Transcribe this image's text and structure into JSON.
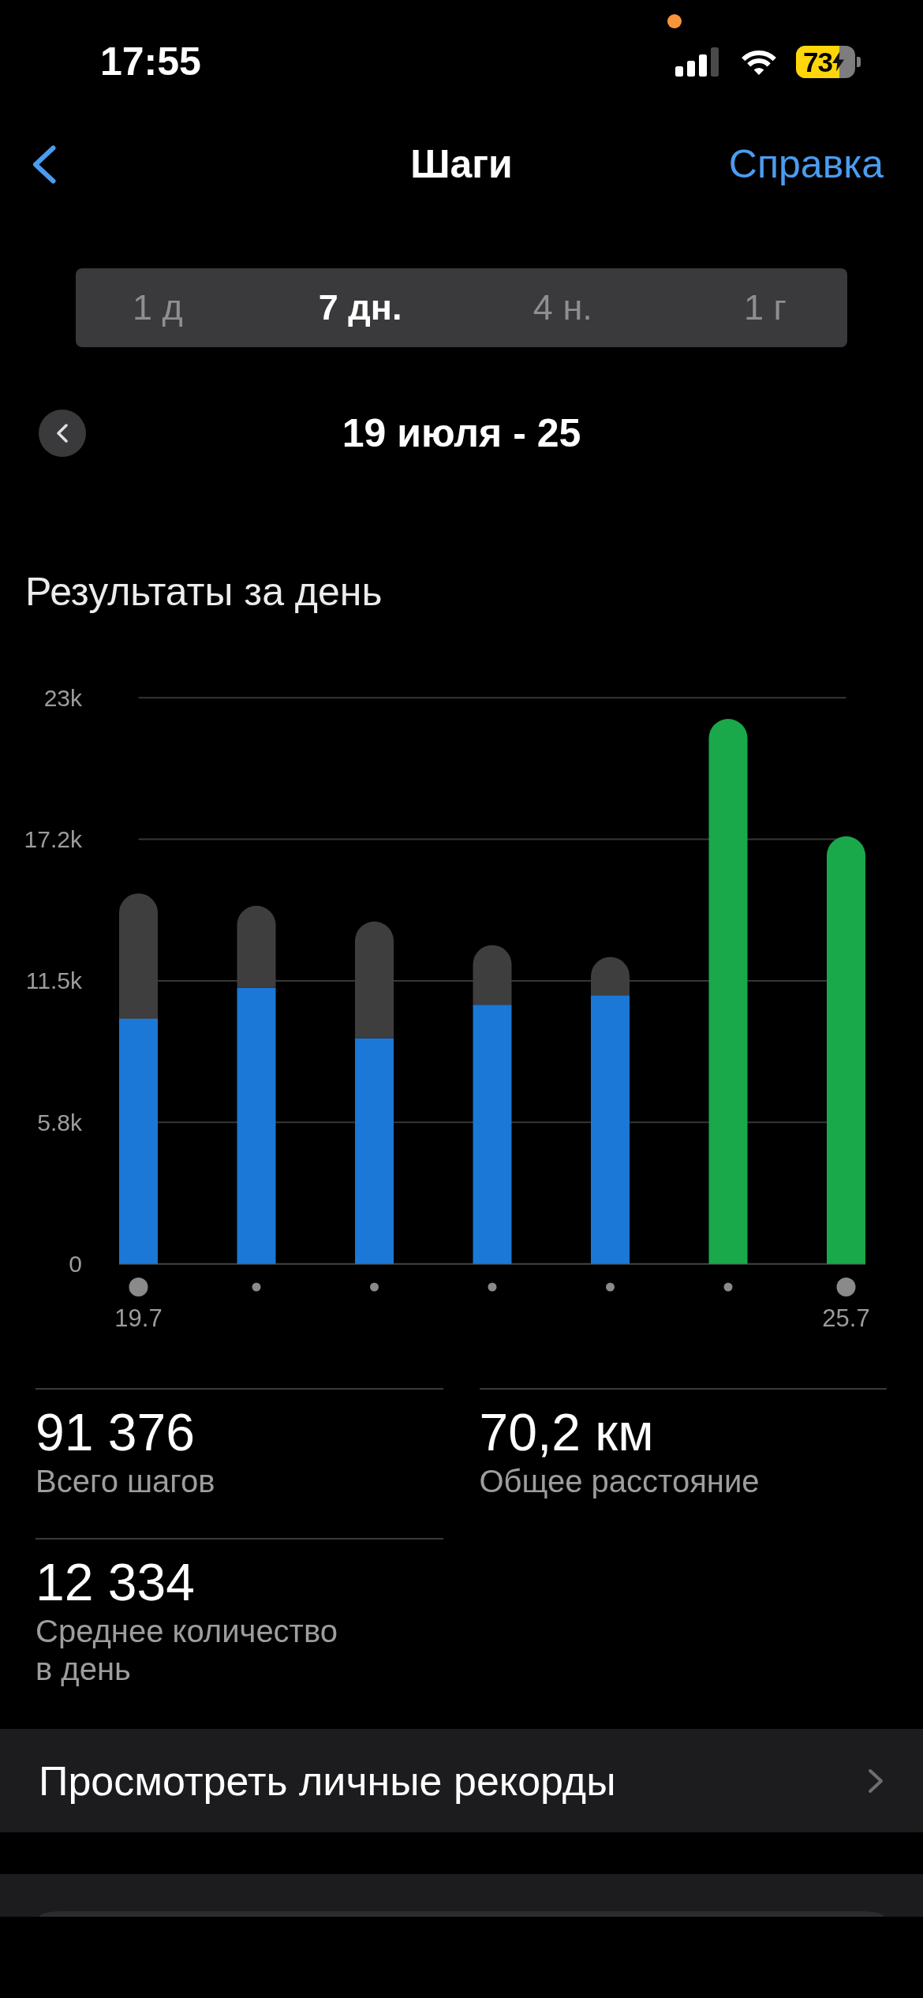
{
  "status_bar": {
    "time": "17:55",
    "battery": "73"
  },
  "nav_bar": {
    "title": "Шаги",
    "action": "Справка"
  },
  "range_tabs": [
    {
      "label": "1 д",
      "selected": false
    },
    {
      "label": "7 дн.",
      "selected": true
    },
    {
      "label": "4 н.",
      "selected": false
    },
    {
      "label": "1 г",
      "selected": false
    }
  ],
  "period": {
    "label": "19 июля - 25"
  },
  "daily_results": {
    "chart_data": {
      "type": "bar",
      "title": "Результаты за день",
      "categories": [
        "19.7",
        null,
        null,
        null,
        null,
        null,
        "25.7"
      ],
      "stacked": true,
      "grid": true,
      "series": [
        {
          "color": "#1b78d6",
          "values": [
            9960,
            11220,
            9170,
            10530,
            10910,
            null,
            null
          ]
        },
        {
          "color": "#19a84a",
          "values": [
            null,
            null,
            null,
            null,
            null,
            22140,
            17370
          ]
        },
        {
          "color": "#3e3e3e",
          "values": [
            5090,
            3330,
            4740,
            2420,
            1560,
            null,
            null
          ]
        }
      ],
      "ylim": [
        0,
        23000
      ],
      "yticks": [
        {
          "value": 0,
          "label": "0"
        },
        {
          "value": 5750,
          "label": "5.8k"
        },
        {
          "value": 11500,
          "label": "11.5k"
        },
        {
          "value": 17250,
          "label": "17.2k"
        },
        {
          "value": 23000,
          "label": "23k"
        }
      ]
    }
  },
  "stats": [
    {
      "value": "91 376",
      "label": "Всего шагов"
    },
    {
      "value": "70,2 км",
      "label": "Общее расстояние"
    },
    {
      "value": "12 334",
      "label": "Среднее количество в день"
    }
  ],
  "records": {
    "label": "Просмотреть личные рекорды"
  }
}
